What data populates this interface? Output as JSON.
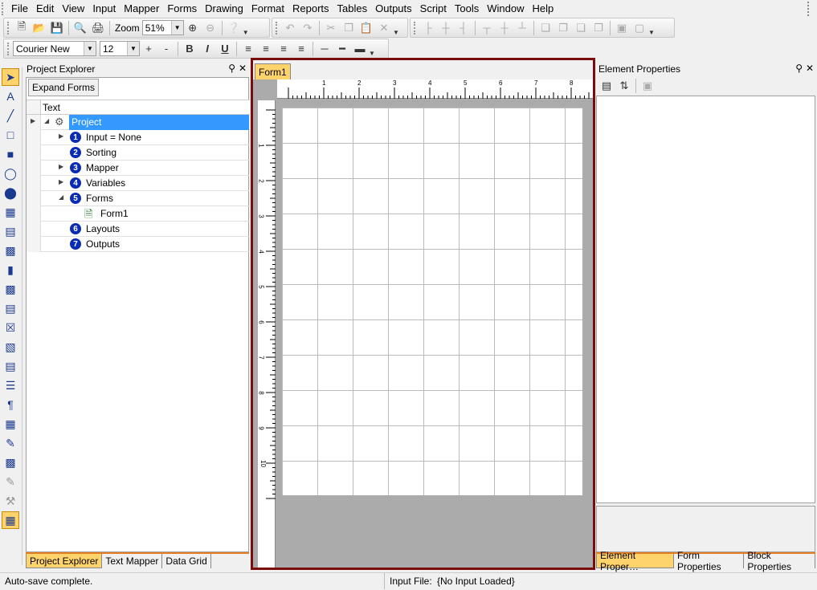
{
  "menu": [
    "File",
    "Edit",
    "View",
    "Input",
    "Mapper",
    "Forms",
    "Drawing",
    "Format",
    "Reports",
    "Tables",
    "Outputs",
    "Script",
    "Tools",
    "Window",
    "Help"
  ],
  "toolbar": {
    "zoom_label": "Zoom",
    "zoom_value": "51%",
    "font_name": "Courier New",
    "font_size": "12",
    "plus_label": "+",
    "minus_label": "-",
    "bold_label": "B",
    "italic_label": "I",
    "underline_label": "U"
  },
  "project_explorer": {
    "title": "Project Explorer",
    "expand_button": "Expand Forms",
    "column_header": "Text",
    "root": "Project",
    "items": [
      {
        "num": "1",
        "label": "Input = None"
      },
      {
        "num": "2",
        "label": "Sorting"
      },
      {
        "num": "3",
        "label": "Mapper"
      },
      {
        "num": "4",
        "label": "Variables"
      },
      {
        "num": "5",
        "label": "Forms"
      },
      {
        "num": "",
        "label": "Form1"
      },
      {
        "num": "6",
        "label": "Layouts"
      },
      {
        "num": "7",
        "label": "Outputs"
      }
    ],
    "tabs": [
      "Project Explorer",
      "Text Mapper",
      "Data Grid"
    ]
  },
  "designer": {
    "tab": "Form1",
    "ruler_h": [
      "1",
      "2",
      "3",
      "4",
      "5",
      "6",
      "7",
      "8"
    ],
    "ruler_v": [
      "1",
      "2",
      "3",
      "4",
      "5",
      "6",
      "7",
      "8",
      "9",
      "10"
    ]
  },
  "element_properties": {
    "title": "Element Properties",
    "tabs": [
      "Element Proper…",
      "Form Properties",
      "Block Properties"
    ]
  },
  "status": {
    "left": "Auto-save complete.",
    "input_label": "Input File:",
    "input_value": "{No Input Loaded}"
  },
  "colors": {
    "accent": "#ffd36b",
    "designer_border": "#7a0c0c",
    "tab_underline": "#e67e22",
    "selection": "#3399ff",
    "number_badge": "#0a2bb5"
  }
}
